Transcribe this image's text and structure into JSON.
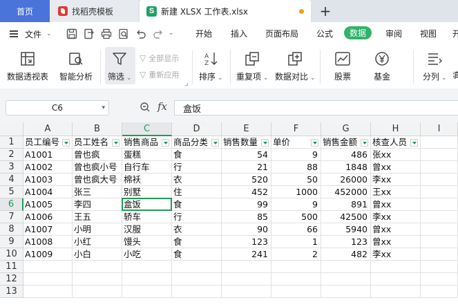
{
  "tabs": {
    "home": "首页",
    "template": "找稻壳模板",
    "file": "新建 XLSX 工作表.xlsx",
    "file_logo": "S"
  },
  "menu": {
    "file": "文件",
    "tabs": [
      "开始",
      "插入",
      "页面布局",
      "公式",
      "数据",
      "审阅",
      "视图",
      "开"
    ]
  },
  "ribbon": {
    "pivot": "数据透视表",
    "smart": "智能分析",
    "filter": "筛选",
    "show_all": "全部显示",
    "reapply": "重新应用",
    "sort": "排序",
    "dup": "重复项",
    "compare": "数据对比",
    "stock": "股票",
    "fund": "基金",
    "split": "分列",
    "next": "填"
  },
  "formula_bar": {
    "cell_ref": "C6",
    "fx": "fx",
    "content": "盒饭"
  },
  "columns": [
    "A",
    "B",
    "C",
    "D",
    "E",
    "F",
    "G",
    "H",
    "I"
  ],
  "rows": [
    "1",
    "2",
    "3",
    "4",
    "5",
    "6",
    "7",
    "8",
    "9",
    "10",
    "11",
    "12",
    "13"
  ],
  "headers": [
    "员工编号",
    "员工姓名",
    "销售商品",
    "商品分类",
    "销售数量",
    "单价",
    "销售金额",
    "核查人员"
  ],
  "records": [
    [
      "A1001",
      "曾也疯",
      "蛋糕",
      "食",
      "54",
      "9",
      "486",
      "张xx"
    ],
    [
      "A1002",
      "曾也疯小号",
      "自行车",
      "行",
      "21",
      "88",
      "1848",
      "曾xx"
    ],
    [
      "A1003",
      "曾也疯大号",
      "棉袄",
      "衣",
      "520",
      "50",
      "26000",
      "李xx"
    ],
    [
      "A1004",
      "张三",
      "别墅",
      "住",
      "452",
      "1000",
      "452000",
      "王xx"
    ],
    [
      "A1005",
      "李四",
      "盒饭",
      "食",
      "99",
      "9",
      "891",
      "曾xx"
    ],
    [
      "A1006",
      "王五",
      "轿车",
      "行",
      "85",
      "500",
      "42500",
      "李xx"
    ],
    [
      "A1007",
      "小明",
      "汉服",
      "衣",
      "90",
      "66",
      "5940",
      "曾xx"
    ],
    [
      "A1008",
      "小红",
      "馒头",
      "食",
      "123",
      "1",
      "123",
      "曾xx"
    ],
    [
      "A1009",
      "小白",
      "小吃",
      "食",
      "241",
      "2",
      "482",
      "李xx"
    ]
  ],
  "active": {
    "col": "C",
    "row": "6"
  },
  "colors": {
    "accent": "#1e9a58",
    "home_tab": "#4a74d9",
    "data_tab": "#2fb368"
  }
}
